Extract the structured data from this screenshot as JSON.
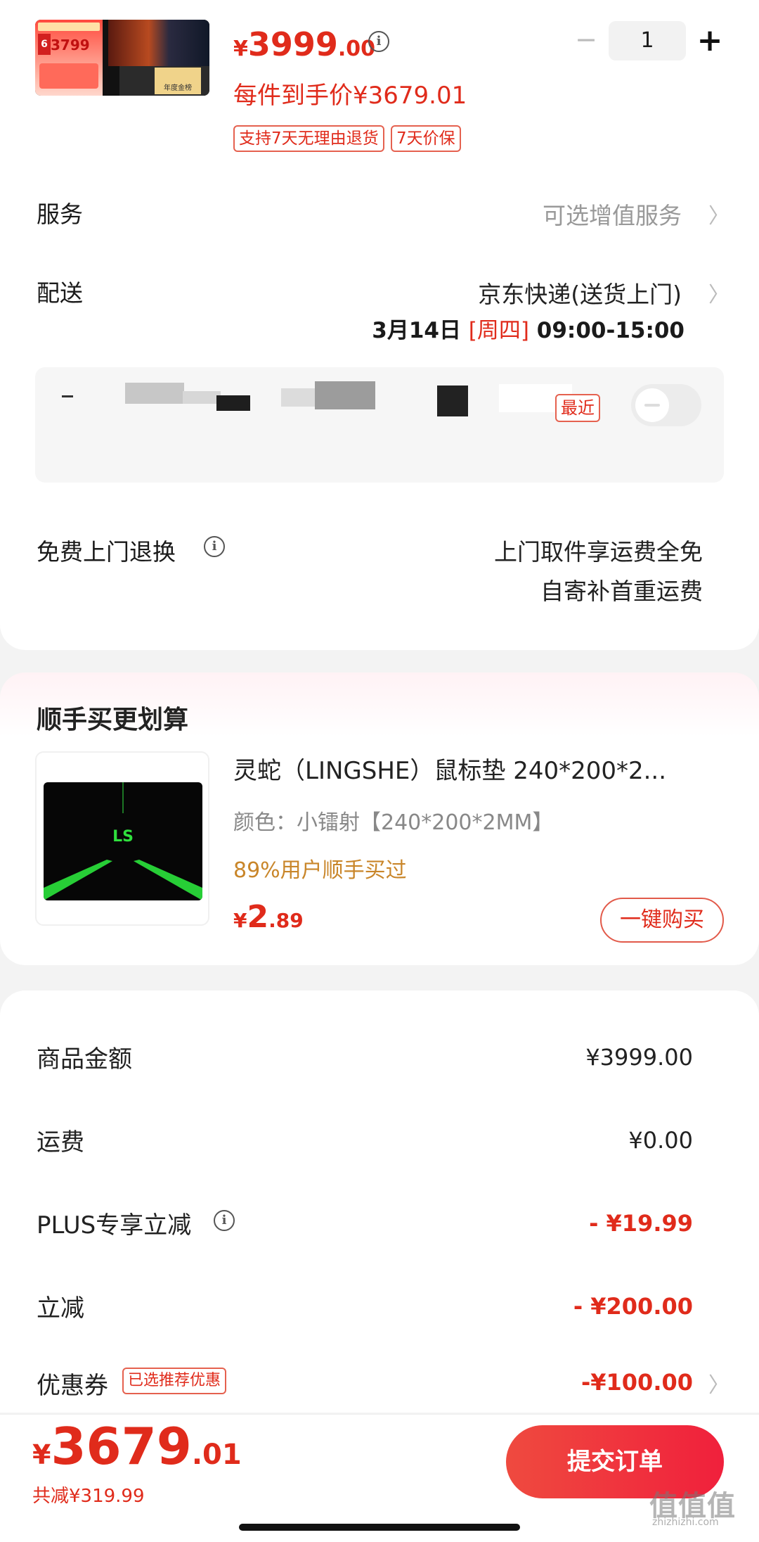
{
  "product": {
    "thumb_promo_price": "3799",
    "thumb_tag": "年度金榜",
    "price_symbol": "¥",
    "price_int": "3999",
    "price_dec": ".00",
    "quantity": "1",
    "per_item_price": "每件到手价¥3679.01",
    "badges": [
      "支持7天无理由退货",
      "7天价保"
    ]
  },
  "service": {
    "label": "服务",
    "value": "可选增值服务"
  },
  "delivery": {
    "label": "配送",
    "value": "京东快递(送货上门)",
    "date": "3月14日",
    "weekday": "[周四]",
    "time": "09:00-15:00",
    "recent_tag": "最近"
  },
  "free_return": {
    "label": "免费上门退换",
    "line1": "上门取件享运费全免",
    "line2": "自寄补首重运费"
  },
  "addon": {
    "section_title": "顺手买更划算",
    "name": "灵蛇（LINGSHE）鼠标垫 240*200*2...",
    "spec": "颜色：小镭射【240*200*2MM】",
    "percent_text": "89%用户顺手买过",
    "price_symbol": "¥",
    "price_int": "2",
    "price_dec": ".89",
    "buy_label": "一键购买"
  },
  "summary": {
    "goods_label": "商品金额",
    "goods_value": "¥3999.00",
    "shipping_label": "运费",
    "shipping_value": "¥0.00",
    "plus_label": "PLUS专享立减",
    "plus_value": "- ¥19.99",
    "instant_label": "立减",
    "instant_value": "- ¥200.00",
    "coupon_label": "优惠券",
    "coupon_tag": "已选推荐优惠",
    "coupon_value": "-¥100.00"
  },
  "bottom": {
    "total_symbol": "¥",
    "total_int": "3679",
    "total_dec": ".01",
    "total_save": "共减¥319.99",
    "submit_label": "提交订单"
  },
  "watermark": {
    "text": "值值值",
    "sub": "zhizhizhi.com"
  },
  "icons": {
    "info": "info-circle-icon",
    "chevron": "chevron-right-icon",
    "minus": "minus-icon",
    "plus": "plus-icon"
  },
  "colors": {
    "accent": "#e02b1b",
    "addon_percent": "#c9862a",
    "button_gradient_start": "#ef4a3f",
    "button_gradient_end": "#f0203c"
  }
}
